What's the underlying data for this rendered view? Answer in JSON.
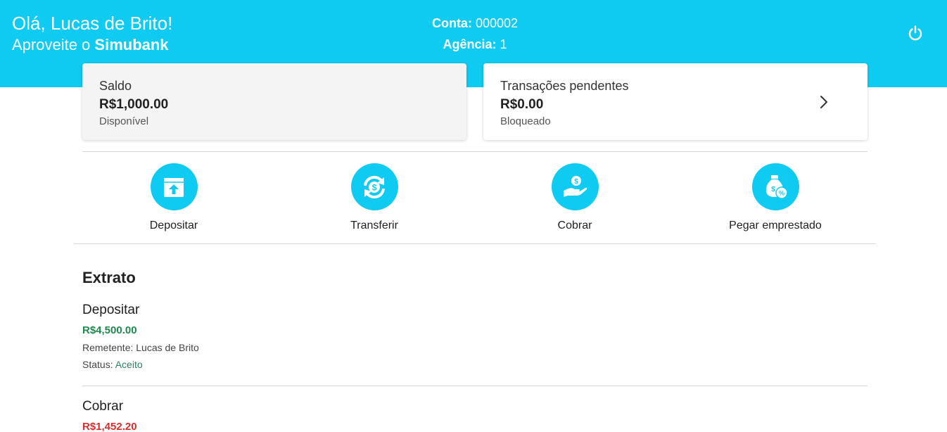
{
  "header": {
    "greeting": "Olá, Lucas de Brito!",
    "tagline_prefix": "Aproveite o ",
    "brand": "Simubank",
    "account_label": "Conta:",
    "account_value": "000002",
    "agency_label": "Agência:",
    "agency_value": "1",
    "logout_icon": "power-icon",
    "color": "#0fcbf1"
  },
  "balance_card": {
    "title": "Saldo",
    "amount": "R$1,000.00",
    "subtitle": "Disponível"
  },
  "pending_card": {
    "title": "Transações pendentes",
    "amount": "R$0.00",
    "subtitle": "Bloqueado",
    "icon": "chevron-right-icon"
  },
  "actions": [
    {
      "label": "Depositar",
      "icon": "deposit-icon"
    },
    {
      "label": "Transferir",
      "icon": "transfer-icon"
    },
    {
      "label": "Cobrar",
      "icon": "charge-icon"
    },
    {
      "label": "Pegar emprestado",
      "icon": "loan-icon"
    }
  ],
  "statement": {
    "title": "Extrato",
    "items": [
      {
        "type": "Depositar",
        "amount": "R$4,500.00",
        "amount_color": "#1e8a4c",
        "sender_label": "Remetente:",
        "sender": "Lucas de Brito",
        "status_label": "Status:",
        "status": "Aceito"
      },
      {
        "type": "Cobrar",
        "amount": "R$1,452.20",
        "amount_color": "#d32f2f"
      }
    ]
  }
}
